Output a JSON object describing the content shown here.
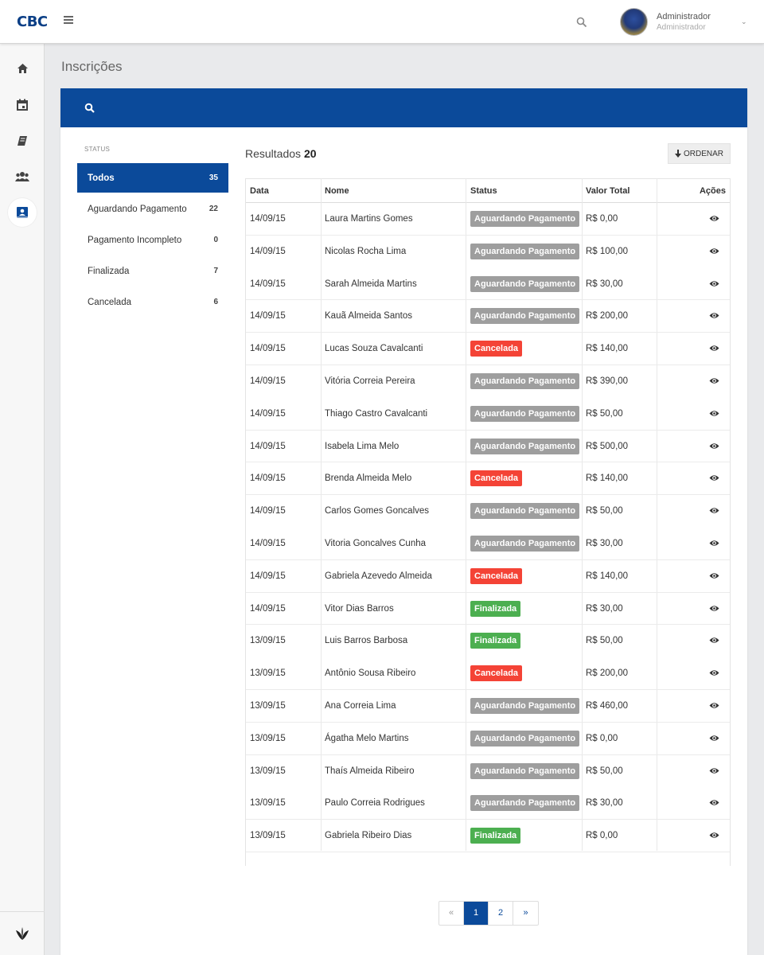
{
  "app": {
    "logo": "CBC",
    "user": {
      "name": "Administrador",
      "role": "Administrador"
    }
  },
  "sidebar": {
    "items": [
      {
        "name": "home-icon",
        "active": false
      },
      {
        "name": "calendar-icon",
        "active": false
      },
      {
        "name": "book-icon",
        "active": false
      },
      {
        "name": "users-icon",
        "active": false
      },
      {
        "name": "registration-card-icon",
        "active": true
      }
    ],
    "bottom_icon": "leaf-logo-icon"
  },
  "page": {
    "title": "Inscrições"
  },
  "filter": {
    "title": "STATUS",
    "items": [
      {
        "label": "Todos",
        "count": "35",
        "active": true
      },
      {
        "label": "Aguardando Pagamento",
        "count": "22",
        "active": false
      },
      {
        "label": "Pagamento Incompleto",
        "count": "0",
        "active": false
      },
      {
        "label": "Finalizada",
        "count": "7",
        "active": false
      },
      {
        "label": "Cancelada",
        "count": "6",
        "active": false
      }
    ]
  },
  "results": {
    "label": "Resultados",
    "count": "20"
  },
  "sort_button": {
    "label": "ORDENAR"
  },
  "table": {
    "headers": [
      "Data",
      "Nome",
      "Status",
      "Valor Total",
      "Ações"
    ],
    "rows": [
      {
        "date": "14/09/15",
        "name": "Laura Martins Gomes",
        "status": "Aguardando Pagamento",
        "value": "R$ 0,00"
      },
      {
        "date": "14/09/15",
        "name": "Nicolas Rocha Lima",
        "status": "Aguardando Pagamento",
        "value": "R$ 100,00"
      },
      {
        "date": "14/09/15",
        "name": "Sarah Almeida Martins",
        "status": "Aguardando Pagamento",
        "value": "R$ 30,00"
      },
      {
        "date": "14/09/15",
        "name": "Kauã Almeida Santos",
        "status": "Aguardando Pagamento",
        "value": "R$ 200,00"
      },
      {
        "date": "14/09/15",
        "name": "Lucas Souza Cavalcanti",
        "status": "Cancelada",
        "value": "R$ 140,00"
      },
      {
        "date": "14/09/15",
        "name": "Vitória Correia Pereira",
        "status": "Aguardando Pagamento",
        "value": "R$ 390,00"
      },
      {
        "date": "14/09/15",
        "name": "Thiago Castro Cavalcanti",
        "status": "Aguardando Pagamento",
        "value": "R$ 50,00"
      },
      {
        "date": "14/09/15",
        "name": "Isabela Lima Melo",
        "status": "Aguardando Pagamento",
        "value": "R$ 500,00"
      },
      {
        "date": "14/09/15",
        "name": "Brenda Almeida Melo",
        "status": "Cancelada",
        "value": "R$ 140,00"
      },
      {
        "date": "14/09/15",
        "name": "Carlos Gomes Goncalves",
        "status": "Aguardando Pagamento",
        "value": "R$ 50,00"
      },
      {
        "date": "14/09/15",
        "name": "Vitoria Goncalves Cunha",
        "status": "Aguardando Pagamento",
        "value": "R$ 30,00"
      },
      {
        "date": "14/09/15",
        "name": "Gabriela Azevedo Almeida",
        "status": "Cancelada",
        "value": "R$ 140,00"
      },
      {
        "date": "14/09/15",
        "name": "Vitor Dias Barros",
        "status": "Finalizada",
        "value": "R$ 30,00"
      },
      {
        "date": "13/09/15",
        "name": "Luis Barros Barbosa",
        "status": "Finalizada",
        "value": "R$ 50,00"
      },
      {
        "date": "13/09/15",
        "name": "Antônio Sousa Ribeiro",
        "status": "Cancelada",
        "value": "R$ 200,00"
      },
      {
        "date": "13/09/15",
        "name": "Ana Correia Lima",
        "status": "Aguardando Pagamento",
        "value": "R$ 460,00"
      },
      {
        "date": "13/09/15",
        "name": "Ágatha Melo Martins",
        "status": "Aguardando Pagamento",
        "value": "R$ 0,00"
      },
      {
        "date": "13/09/15",
        "name": "Thaís Almeida Ribeiro",
        "status": "Aguardando Pagamento",
        "value": "R$ 50,00"
      },
      {
        "date": "13/09/15",
        "name": "Paulo Correia Rodrigues",
        "status": "Aguardando Pagamento",
        "value": "R$ 30,00"
      },
      {
        "date": "13/09/15",
        "name": "Gabriela Ribeiro Dias",
        "status": "Finalizada",
        "value": "R$ 0,00"
      }
    ],
    "action_icon": "eye-icon"
  },
  "status_colors": {
    "Aguardando Pagamento": "#9e9e9e",
    "Cancelada": "#f44336",
    "Finalizada": "#4caf50"
  },
  "pagination": {
    "prev": "«",
    "pages": [
      "1",
      "2"
    ],
    "current": "1",
    "next": "»"
  },
  "colors": {
    "brand": "#0b4a9a",
    "logo": "#0b3f86"
  }
}
